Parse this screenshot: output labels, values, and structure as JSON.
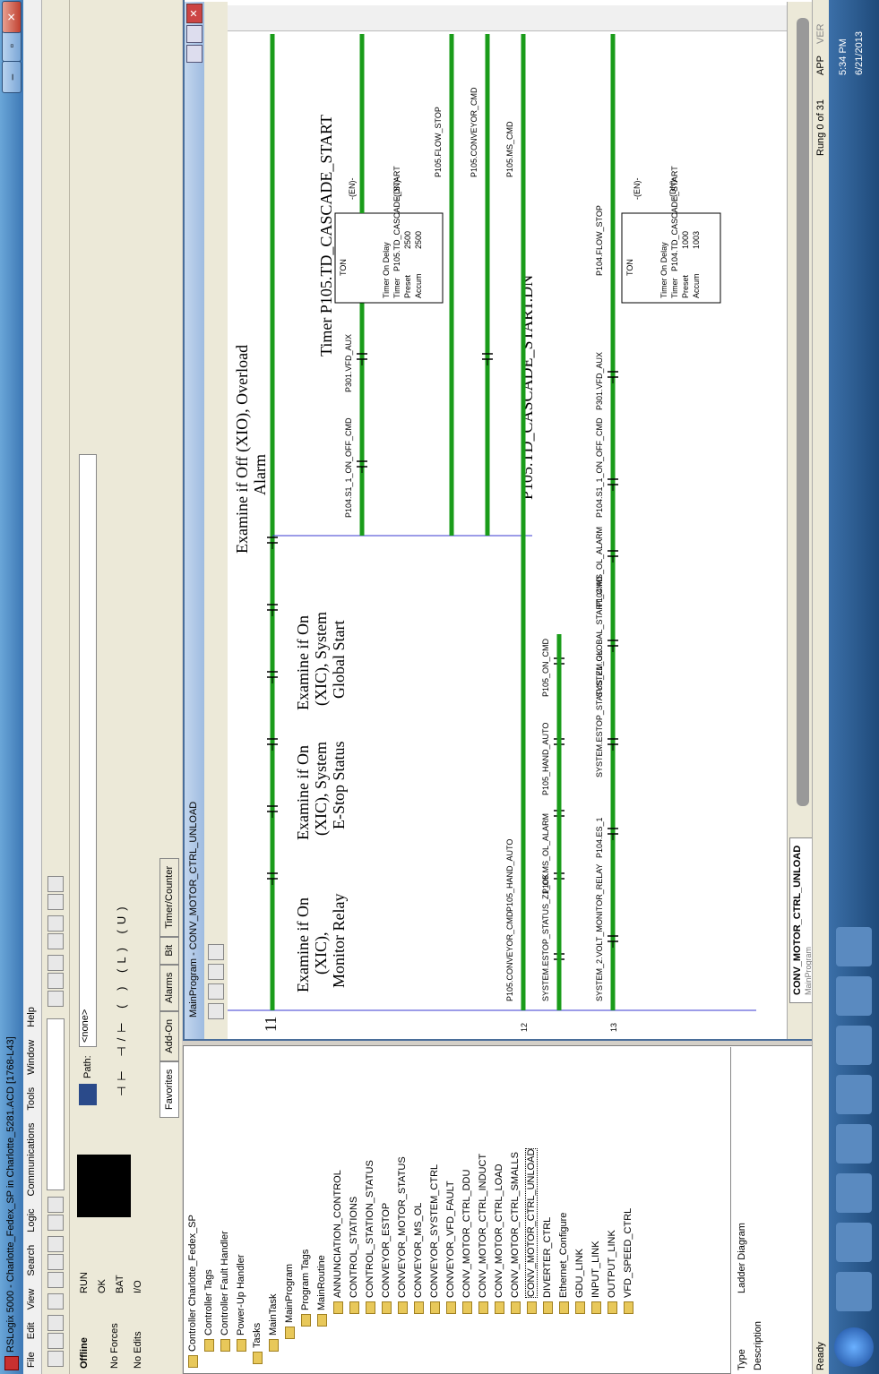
{
  "window": {
    "title": "RSLogix 5000 - Charlotte_Fedex_SP in Charlotte_5281.ACD [1768-L43]"
  },
  "menu": [
    "File",
    "Edit",
    "View",
    "Search",
    "Logic",
    "Communications",
    "Tools",
    "Window",
    "Help"
  ],
  "status": {
    "mode": "Offline",
    "forces": "No Forces",
    "edits": "No Edits",
    "run": "RUN",
    "ok": "OK",
    "bat": "BAT",
    "io": "I/O",
    "path_label": "Path:",
    "path_value": "<none>"
  },
  "instr_tabs": [
    "Favorites",
    "Add-On",
    "Alarms",
    "Bit",
    "Timer/Counter"
  ],
  "tree": {
    "controller": "Controller Charlotte_Fedex_SP",
    "items": [
      "Controller Tags",
      "Controller Fault Handler",
      "Power-Up Handler",
      "Tasks",
      "MainTask",
      "MainProgram",
      "Program Tags",
      "MainRoutine",
      "ANNUNCIATION_CONTROL",
      "CONTROL_STATIONS",
      "CONTROL_STATION_STATUS",
      "CONVEYOR_ESTOP",
      "CONVEYOR_MOTOR_STATUS",
      "CONVEYOR_MS_OL",
      "CONVEYOR_SYSTEM_CTRL",
      "CONVEYOR_VFD_FAULT",
      "CONV_MOTOR_CTRL_DDU",
      "CONV_MOTOR_CTRL_INDUCT",
      "CONV_MOTOR_CTRL_LOAD",
      "CONV_MOTOR_CTRL_SMALLS",
      "CONV_MOTOR_CTRL_UNLOAD",
      "DIVERTER_CTRL",
      "Ethernet_Configure",
      "GDU_LINK",
      "INPUT_LINK",
      "OUTPUT_LINK",
      "VFD_SPEED_CTRL"
    ]
  },
  "props": {
    "type_label": "Type",
    "type_value": "Ladder Diagram",
    "desc_label": "Description"
  },
  "ladder": {
    "window_title": "MainProgram - CONV_MOTOR_CTRL_UNLOAD",
    "tab_label": "CONV_MOTOR_CTRL_UNLOAD",
    "tab_sub": "MainProgram",
    "rung11": "11",
    "rung12": "12",
    "rung13": "13",
    "ann_monitor": "Examine if On (XIC), Monitor Relay",
    "ann_estop": "Examine if On (XIC), System E-Stop Status",
    "ann_global": "Examine if On (XIC), System Global Start",
    "ann_overload": "Examine if Off (XIO), Overload Alarm",
    "ann_timer": "Timer P105.TD_CASCADE_START",
    "ann_dn": "P105.TD_CASCADE_START.DN",
    "r12_tags": [
      "P105.CONVEYOR_CMD",
      "P105_HAND_AUTO",
      "SYSTEM.ESTOP_STATUS_Z1_OK",
      "P105.MS_OL_ALARM",
      "P105_HAND_AUTO",
      "P105_ON_CMD",
      "P105.MS_CMD"
    ],
    "r11_tags": [
      "P104.S1_1_ON_OFF_CMD",
      "P301.VFD_AUX",
      "P105.FLOW_STOP",
      "P105.CONVEYOR_CMD"
    ],
    "r13_tags": [
      "SYSTEM_2.VOLT_MONITOR_RELAY",
      "P104.ES_1",
      "SYSTEM.ESTOP_STATUS_Z1_OK",
      "SYSTEM.GLOBAL_START_CMD",
      "P104.MS_OL_ALARM",
      "P104.S1_1_ON_OFF_CMD",
      "P301.VFD_AUX",
      "P104.FLOW_STOP"
    ],
    "ton1": {
      "kind": "TON",
      "title": "Timer On Delay",
      "timer_lbl": "Timer",
      "timer": "P105.TD_CASCADE_START",
      "preset_lbl": "Preset",
      "preset": "2500",
      "accum_lbl": "Accum",
      "accum": "2500"
    },
    "ton2": {
      "kind": "TON",
      "title": "Timer On Delay",
      "timer_lbl": "Timer",
      "timer": "P104.TD_CASCADE_START",
      "preset_lbl": "Preset",
      "preset": "1000",
      "accum_lbl": "Accum",
      "accum": "1003"
    },
    "en": "EN",
    "dn": "DN"
  },
  "statusbar": {
    "ready": "Ready",
    "rung": "Rung 0 of 31",
    "app": "APP",
    "ver": "VER"
  },
  "taskbar": {
    "time": "5:34 PM",
    "date": "6/21/2013"
  },
  "colors": {
    "contact_green": "#1a9c1a",
    "rail_blue": "#3a3ad0"
  }
}
